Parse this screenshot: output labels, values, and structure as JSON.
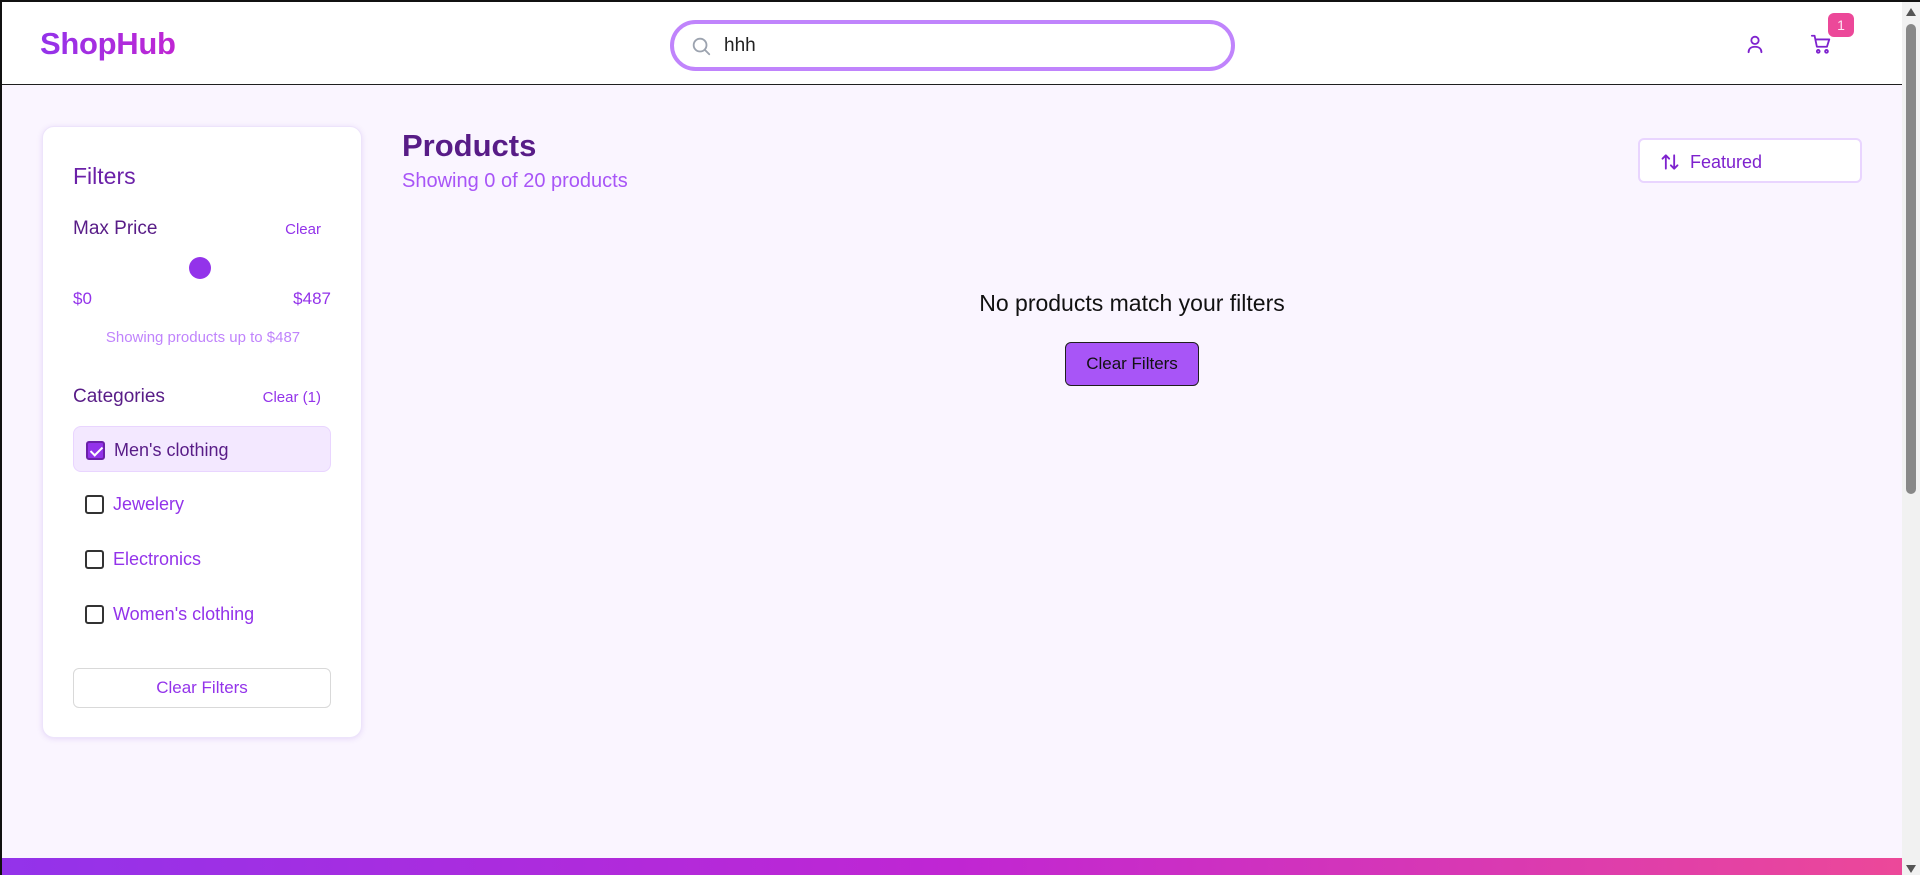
{
  "header": {
    "logo": "ShopHub",
    "search": {
      "value": "hhh",
      "placeholder": ""
    },
    "cart_count": "1"
  },
  "sidebar": {
    "title": "Filters",
    "price": {
      "title": "Max Price",
      "clear_label": "Clear",
      "min_label": "$0",
      "max_label": "$487",
      "note": "Showing products up to $487"
    },
    "categories": {
      "title": "Categories",
      "clear_label": "Clear (1)",
      "items": [
        {
          "label": "Men's clothing",
          "checked": true
        },
        {
          "label": "Jewelery",
          "checked": false
        },
        {
          "label": "Electronics",
          "checked": false
        },
        {
          "label": "Women's clothing",
          "checked": false
        }
      ]
    },
    "clear_filters_label": "Clear Filters"
  },
  "main": {
    "title": "Products",
    "subtitle": "Showing 0 of 20 products",
    "sort_label": "Featured",
    "empty_message": "No products match your filters",
    "clear_filters_label": "Clear Filters"
  },
  "colors": {
    "accent": "#9333ea",
    "badge": "#ec4899",
    "background": "#faf5ff"
  },
  "icons": {
    "search": "search-icon",
    "user": "user-icon",
    "cart": "cart-icon",
    "sort": "sort-icon"
  }
}
